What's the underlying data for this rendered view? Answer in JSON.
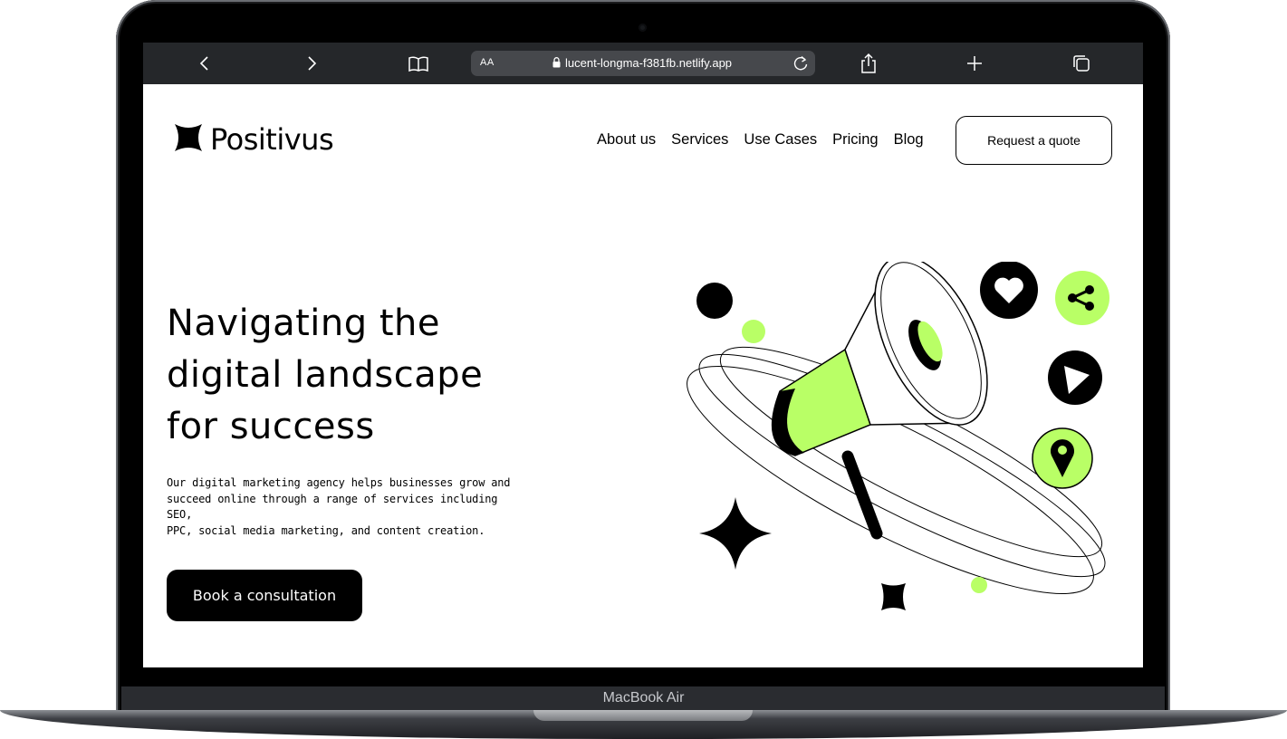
{
  "colors": {
    "accent": "#b9ff66",
    "text": "#000000",
    "browser_bar": "#25272a",
    "url_field": "#46484c"
  },
  "device": {
    "label": "MacBook Air"
  },
  "browser": {
    "text_size_label": "AA",
    "url": "lucent-longma-f381fb.netlify.app",
    "icons": [
      "back-icon",
      "forward-icon",
      "bookmarks-icon",
      "lock-icon",
      "reload-icon",
      "share-icon",
      "new-tab-icon",
      "tabs-icon"
    ]
  },
  "site": {
    "brand": "Positivus",
    "nav": [
      "About us",
      "Services",
      "Use Cases",
      "Pricing",
      "Blog"
    ],
    "quote_button": "Request a quote",
    "hero": {
      "title_lines": [
        "Navigating the",
        "digital landscape",
        "for success"
      ],
      "description_lines": [
        "Our digital marketing agency helps businesses grow and",
        "succeed online through a range of services including SEO,",
        "PPC, social media marketing, and content creation."
      ],
      "cta": "Book a consultation"
    },
    "illustration_icons": [
      "megaphone-icon",
      "heart-icon",
      "share-icon",
      "play-icon",
      "location-pin-icon",
      "star-icon"
    ]
  }
}
